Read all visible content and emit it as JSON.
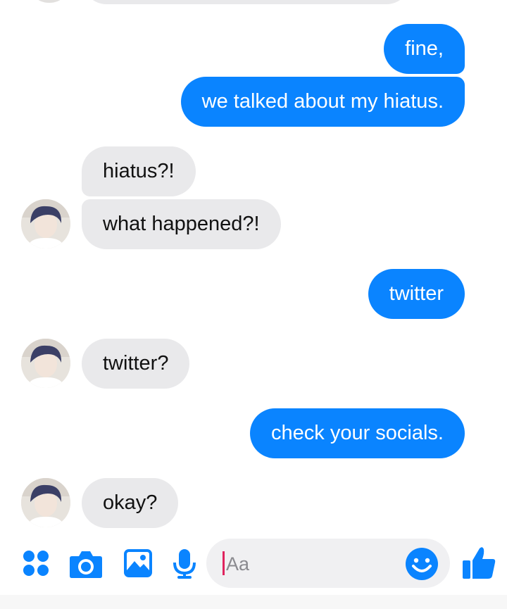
{
  "messages": [
    {
      "from": "me",
      "text": "fine,"
    },
    {
      "from": "me",
      "text": "we talked about my hiatus."
    },
    {
      "from": "them",
      "text": "hiatus?!"
    },
    {
      "from": "them",
      "text": "what happened?!"
    },
    {
      "from": "me",
      "text": "twitter"
    },
    {
      "from": "them",
      "text": "twitter?"
    },
    {
      "from": "me",
      "text": "check your socials."
    },
    {
      "from": "them",
      "text": "okay?"
    }
  ],
  "composer": {
    "placeholder": "Aa"
  },
  "toolbar": {
    "icons": [
      "apps-icon",
      "camera-icon",
      "gallery-icon",
      "microphone-icon",
      "emoji-icon",
      "thumbs-up-icon"
    ]
  },
  "colors": {
    "accent": "#0a84ff",
    "incoming": "#e9e9eb",
    "caret": "#e0245e"
  }
}
